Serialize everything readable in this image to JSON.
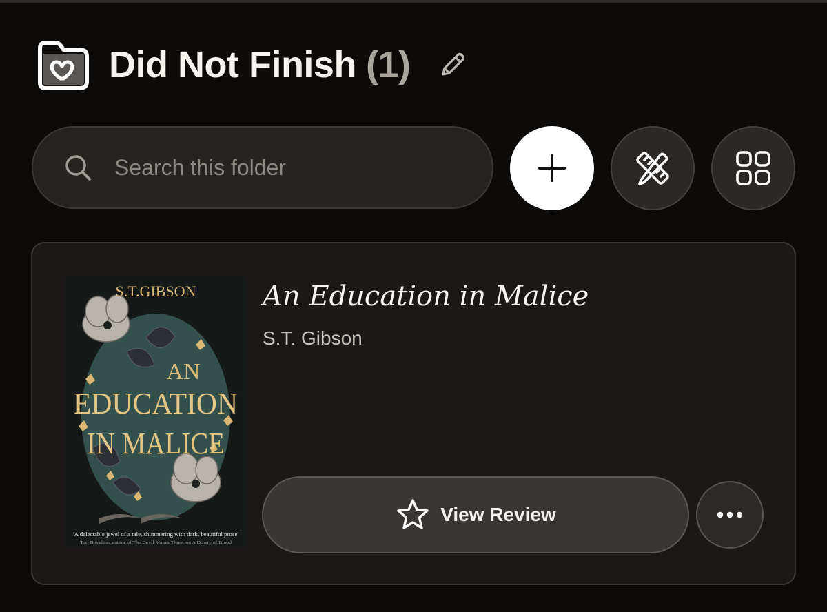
{
  "header": {
    "title": "Did Not Finish",
    "count": "(1)",
    "folder_icon": "folder-heart-icon",
    "edit_icon": "pencil-icon"
  },
  "search": {
    "placeholder": "Search this folder",
    "value": "",
    "icon": "search-icon"
  },
  "toolbar": {
    "add_icon": "plus-icon",
    "tools_icon": "ruler-pencil-icon",
    "view_icon": "grid-icon"
  },
  "book": {
    "title": "An Education in Malice",
    "author": "S.T. Gibson",
    "cover": {
      "author_line": "S.T.GIBSON",
      "title_line_1": "AN",
      "title_line_2": "EDUCATION",
      "title_line_3": "IN MALICE",
      "quote": "'A delectable jewel of a tale, shimmering with dark, beautiful prose'",
      "quote_attribution": "Tori Bovalino, author of The Devil Makes Three, on A Dowry of Blood"
    },
    "review_button_label": "View Review",
    "review_icon": "star-icon",
    "more_icon": "ellipsis-icon"
  },
  "colors": {
    "background": "#0c0b0a",
    "card": "#1b1817",
    "button": "#3a3633",
    "accent_white": "#ffffff",
    "cover_gold": "#d9b774",
    "cover_teal": "#34504c"
  }
}
